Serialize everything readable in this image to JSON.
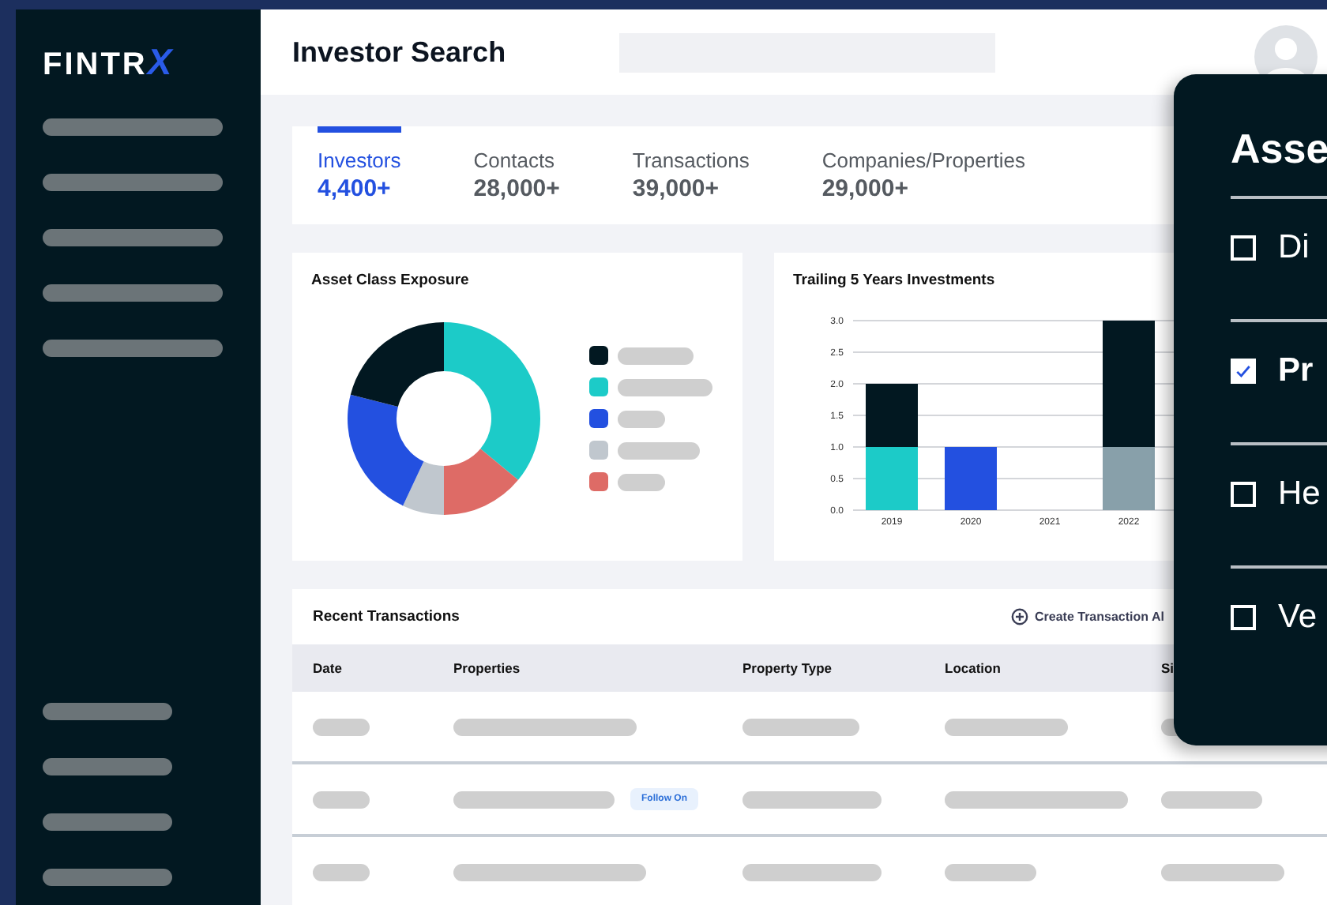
{
  "sidebar": {
    "logo": {
      "text": "FINTR",
      "accent": "X"
    }
  },
  "header": {
    "title": "Investor Search"
  },
  "tabs": [
    {
      "label": "Investors",
      "count": "4,400+",
      "selected": true
    },
    {
      "label": "Contacts",
      "count": "28,000+",
      "selected": false
    },
    {
      "label": "Transactions",
      "count": "39,000+",
      "selected": false
    },
    {
      "label": "Companies/Properties",
      "count": "29,000+",
      "selected": false
    }
  ],
  "asset_card": {
    "title": "Asset Class Exposure",
    "legend": [
      {
        "color": "#021821"
      },
      {
        "color": "#1ccbc8"
      },
      {
        "color": "#2350e0"
      },
      {
        "color": "#c0c7ce"
      },
      {
        "color": "#de6b66"
      }
    ]
  },
  "investments_card": {
    "chart_data": {
      "type": "bar",
      "title": "Trailing 5 Years Investments",
      "categories": [
        "2019",
        "2020",
        "2021",
        "2022"
      ],
      "stacked": true,
      "grid": true,
      "ylim": [
        0,
        3
      ],
      "yticks": [
        {
          "value": 0,
          "label": "0.0"
        },
        {
          "value": 0.5,
          "label": "0.5"
        },
        {
          "value": 1,
          "label": "1.0"
        },
        {
          "value": 1.5,
          "label": "1.5"
        },
        {
          "value": 2,
          "label": "2.0"
        },
        {
          "value": 2.5,
          "label": "2.5"
        },
        {
          "value": 3,
          "label": "3.0"
        }
      ],
      "series": [
        {
          "color": "#1ccbc8",
          "values": [
            1,
            0,
            0,
            0
          ]
        },
        {
          "color": "#2350e0",
          "values": [
            0,
            1,
            0,
            0
          ]
        },
        {
          "color": "#88a0aa",
          "values": [
            0,
            0,
            0,
            1
          ]
        },
        {
          "color": "#021821",
          "values": [
            1,
            0,
            0,
            2
          ]
        }
      ]
    }
  },
  "transactions": {
    "title": "Recent Transactions",
    "action": "Create Transaction Al",
    "columns": [
      "Date",
      "Properties",
      "Property Type",
      "Location",
      "Si"
    ],
    "rows": [
      {
        "kind": "plain"
      },
      {
        "kind": "tagged",
        "badge": "Follow On"
      },
      {
        "kind": "plain"
      }
    ]
  },
  "popup": {
    "title": "Asse",
    "options": [
      {
        "label": "Di",
        "checked": false
      },
      {
        "label": "Pr",
        "checked": true
      },
      {
        "label": "He",
        "checked": false
      },
      {
        "label": "Ve",
        "checked": false
      }
    ]
  }
}
